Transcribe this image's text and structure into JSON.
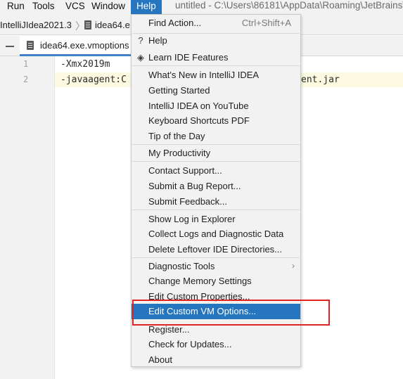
{
  "menubar": {
    "items": [
      {
        "label": "Run"
      },
      {
        "label": "Tools"
      },
      {
        "label": "VCS"
      },
      {
        "label": "Window"
      },
      {
        "label": "Help"
      }
    ],
    "window_title": "untitled - C:\\Users\\86181\\AppData\\Roaming\\JetBrains\\"
  },
  "breadcrumb": {
    "items": [
      {
        "label": "IntelliJIdea2021.3"
      },
      {
        "label": "idea64.e"
      }
    ]
  },
  "tabs": [
    {
      "label": "idea64.exe.vmoptions"
    }
  ],
  "editor": {
    "lines": [
      {
        "number": "1",
        "text": "-Xmx2019m"
      },
      {
        "number": "2",
        "text": "-javaagent:C",
        "tail": "ent.jar"
      }
    ]
  },
  "help_menu": {
    "items": [
      {
        "label": "Find Action...",
        "shortcut": "Ctrl+Shift+A"
      },
      {
        "label": "Help",
        "icon": "question-icon"
      },
      {
        "label": "Learn IDE Features",
        "icon": "graduation-cap-icon"
      },
      {
        "label": "What's New in IntelliJ IDEA"
      },
      {
        "label": "Getting Started"
      },
      {
        "label": "IntelliJ IDEA on YouTube"
      },
      {
        "label": "Keyboard Shortcuts PDF"
      },
      {
        "label": "Tip of the Day"
      },
      {
        "label": "My Productivity"
      },
      {
        "label": "Contact Support..."
      },
      {
        "label": "Submit a Bug Report..."
      },
      {
        "label": "Submit Feedback..."
      },
      {
        "label": "Show Log in Explorer"
      },
      {
        "label": "Collect Logs and Diagnostic Data"
      },
      {
        "label": "Delete Leftover IDE Directories..."
      },
      {
        "label": "Diagnostic Tools",
        "submenu": true
      },
      {
        "label": "Change Memory Settings"
      },
      {
        "label": "Edit Custom Properties..."
      },
      {
        "label": "Edit Custom VM Options...",
        "selected": true
      },
      {
        "label": "Register..."
      },
      {
        "label": "Check for Updates..."
      },
      {
        "label": "About"
      }
    ]
  },
  "colors": {
    "menu_selection": "#2675bf",
    "annotation_box": "#e32424",
    "tab_underline": "#4083c9"
  }
}
